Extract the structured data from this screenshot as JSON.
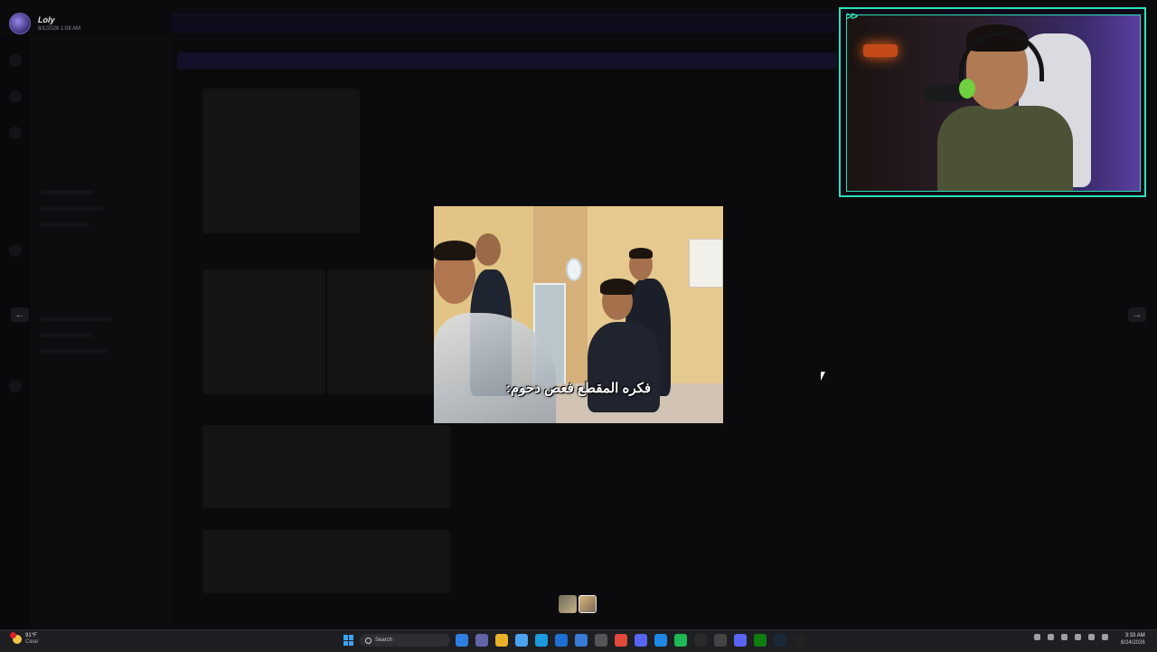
{
  "viewer": {
    "author": "Loly",
    "timestamp": "8/1/2026 1:08 AM",
    "caption": "فكره المقطع فعص دحوم:",
    "prev_icon": "arrow-left-icon",
    "next_icon": "arrow-right-icon"
  },
  "webcam": {
    "overlay_mark": ">>",
    "border_color": "#2de0b8"
  },
  "taskbar": {
    "weather_temp": "91°F",
    "weather_cond": "Clear",
    "search_label": "Search",
    "clock_time": "3:33 AM",
    "clock_date": "8/24/2026",
    "apps": [
      {
        "name": "file-explorer-icon",
        "color": "#2f7fe0"
      },
      {
        "name": "teams-icon",
        "color": "#6264a7"
      },
      {
        "name": "folder-icon",
        "color": "#e8b02b"
      },
      {
        "name": "copilot-icon",
        "color": "#4aa3f0"
      },
      {
        "name": "edge-icon",
        "color": "#1a9be0"
      },
      {
        "name": "outlook-icon",
        "color": "#1d6fd1"
      },
      {
        "name": "store-icon",
        "color": "#3a7bd5"
      },
      {
        "name": "app-icon",
        "color": "#555"
      },
      {
        "name": "chrome-icon",
        "color": "#e0493b"
      },
      {
        "name": "discord-icon",
        "color": "#5865f2"
      },
      {
        "name": "messenger-icon",
        "color": "#1e88e5"
      },
      {
        "name": "spotify-icon",
        "color": "#1db954"
      },
      {
        "name": "chatgpt-icon",
        "color": "#2a2a2a"
      },
      {
        "name": "settings-icon",
        "color": "#444"
      },
      {
        "name": "discord-2-icon",
        "color": "#5865f2"
      },
      {
        "name": "xbox-icon",
        "color": "#107c10"
      },
      {
        "name": "steam-icon",
        "color": "#1b2838"
      },
      {
        "name": "terminal-icon",
        "color": "#222"
      }
    ]
  }
}
